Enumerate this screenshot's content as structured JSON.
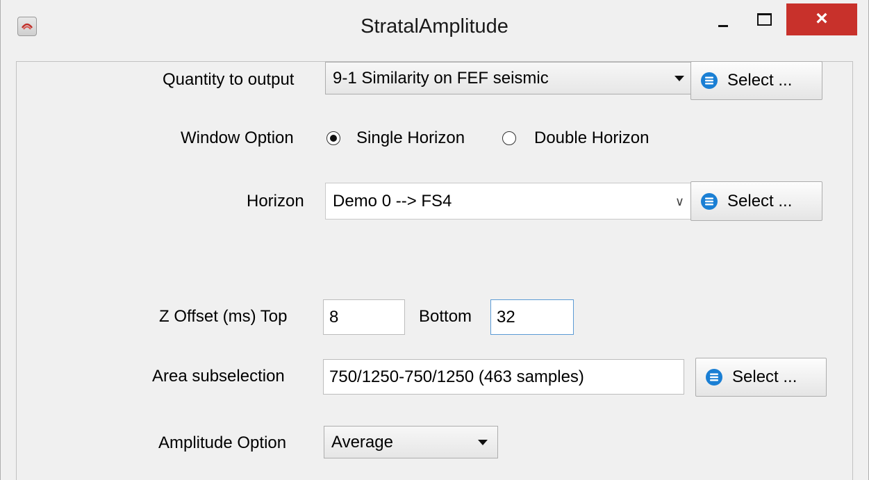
{
  "window": {
    "title": "StratalAmplitude",
    "close_label": "×"
  },
  "quantity": {
    "label": "Quantity to output",
    "value": "9-1 Similarity on FEF seismic",
    "button": "Select ..."
  },
  "window_option": {
    "label": "Window Option",
    "options": [
      "Single Horizon",
      "Double Horizon"
    ],
    "selected": "Single Horizon"
  },
  "horizon": {
    "label": "Horizon",
    "value": "Demo 0 --> FS4",
    "button": "Select ..."
  },
  "z_offset": {
    "label": "Z Offset (ms) Top",
    "top_value": "8",
    "bottom_label": "Bottom",
    "bottom_value": "32"
  },
  "area": {
    "label": "Area subselection",
    "value": "750/1250-750/1250 (463 samples)",
    "button": "Select ..."
  },
  "amplitude": {
    "label": "Amplitude Option",
    "value": "Average"
  },
  "colors": {
    "close": "#c8312b",
    "select_icon": "#1a7fd4",
    "focus": "#5b9bd5"
  }
}
